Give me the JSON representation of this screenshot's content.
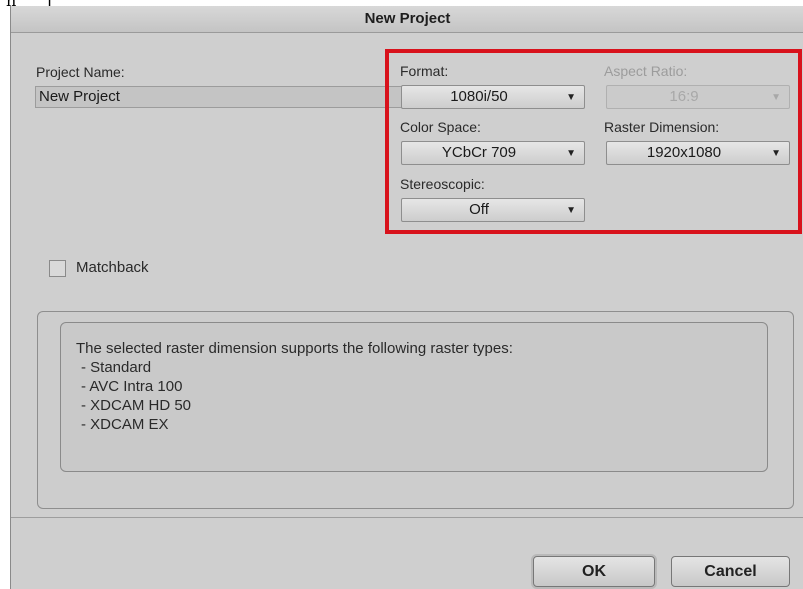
{
  "dialog": {
    "title": "New Project"
  },
  "project_name": {
    "label": "Project Name:",
    "value": "New Project"
  },
  "format": {
    "label": "Format:",
    "value": "1080i/50"
  },
  "aspect_ratio": {
    "label": "Aspect Ratio:",
    "value": "16:9",
    "disabled": true
  },
  "color_space": {
    "label": "Color Space:",
    "value": "YCbCr 709"
  },
  "raster_dimension": {
    "label": "Raster Dimension:",
    "value": "1920x1080"
  },
  "stereoscopic": {
    "label": "Stereoscopic:",
    "value": "Off"
  },
  "matchback": {
    "label": "Matchback",
    "checked": false
  },
  "info": {
    "heading": "The selected raster dimension supports the following raster types:",
    "items": [
      "- Standard",
      "- AVC Intra 100",
      "- XDCAM HD 50",
      "- XDCAM EX"
    ]
  },
  "buttons": {
    "ok": "OK",
    "cancel": "Cancel"
  },
  "colors": {
    "highlight": "#d8121c",
    "dialog_bg": "#cfcfcf"
  },
  "icons": {
    "dropdown_arrow": "triangle-down-icon"
  }
}
